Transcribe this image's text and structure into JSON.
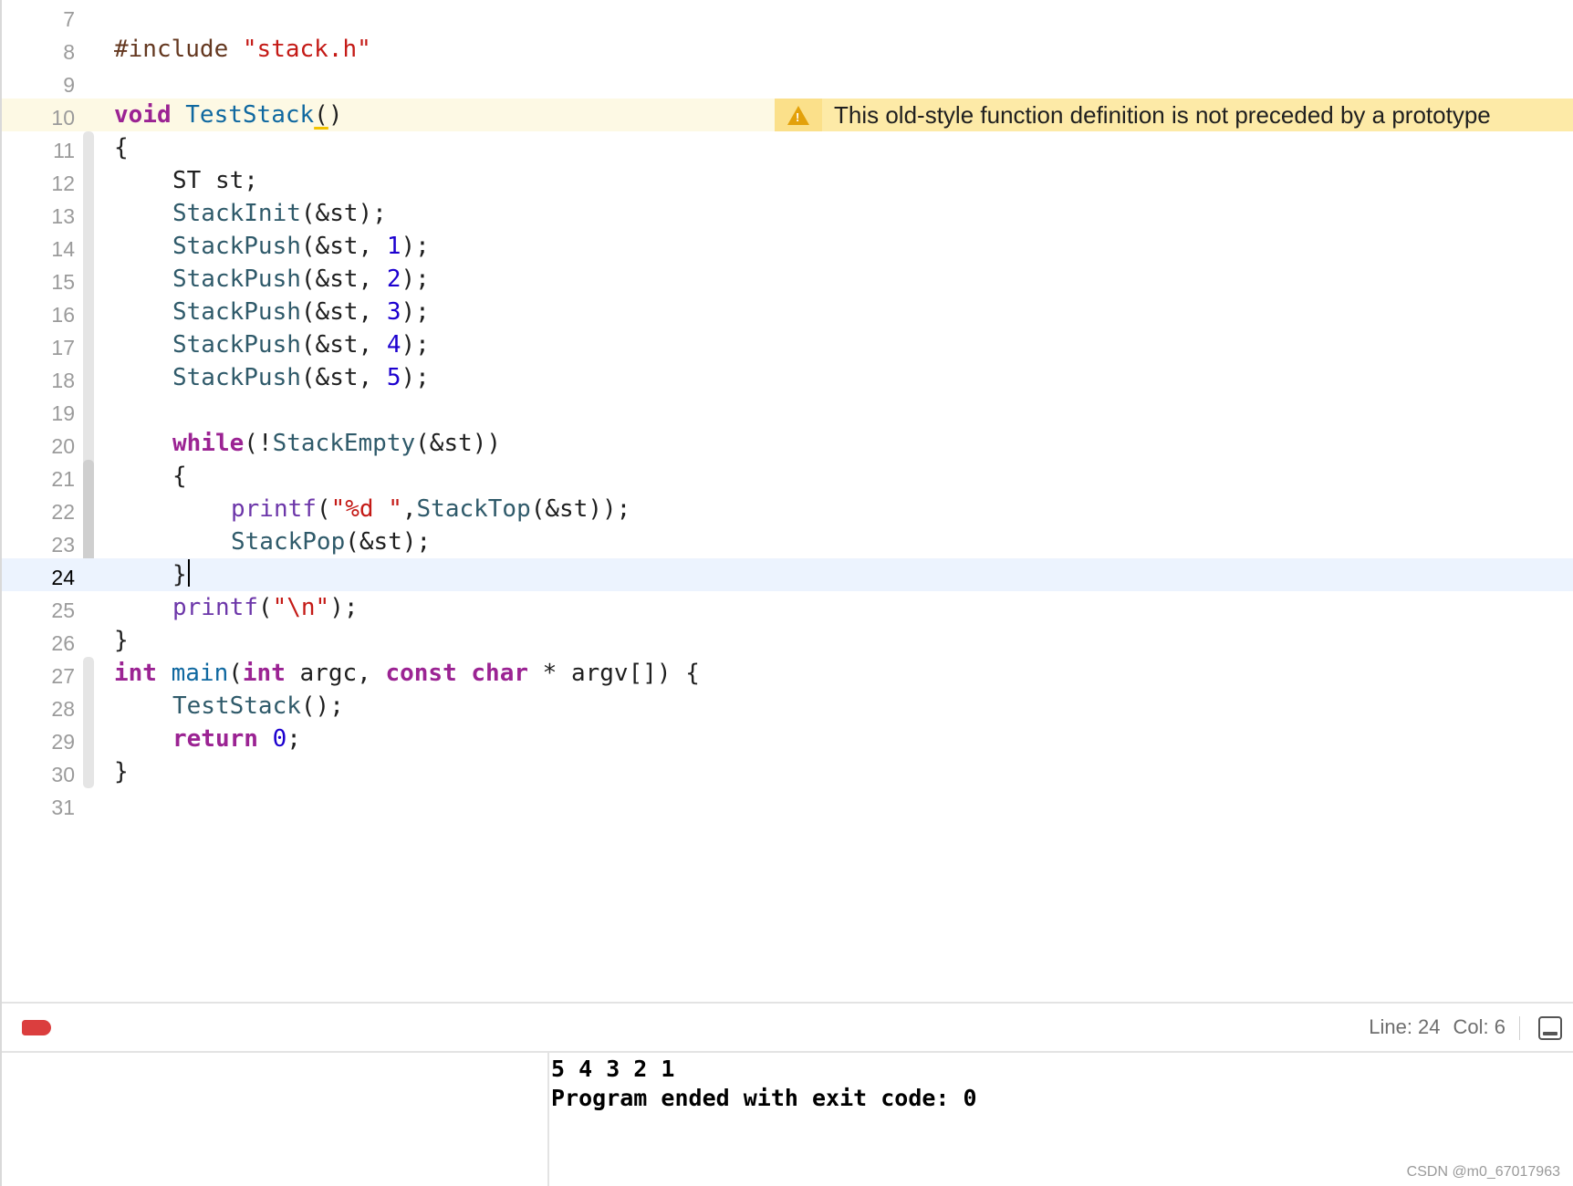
{
  "editor": {
    "current_line": "24",
    "lines": [
      {
        "n": "7"
      },
      {
        "n": "8"
      },
      {
        "n": "9"
      },
      {
        "n": "10"
      },
      {
        "n": "11"
      },
      {
        "n": "12"
      },
      {
        "n": "13"
      },
      {
        "n": "14"
      },
      {
        "n": "15"
      },
      {
        "n": "16"
      },
      {
        "n": "17"
      },
      {
        "n": "18"
      },
      {
        "n": "19"
      },
      {
        "n": "20"
      },
      {
        "n": "21"
      },
      {
        "n": "22"
      },
      {
        "n": "23"
      },
      {
        "n": "24"
      },
      {
        "n": "25"
      },
      {
        "n": "26"
      },
      {
        "n": "27"
      },
      {
        "n": "28"
      },
      {
        "n": "29"
      },
      {
        "n": "30"
      },
      {
        "n": "31"
      }
    ],
    "tokens": {
      "l8_pre": "#include ",
      "l8_str": "\"stack.h\"",
      "l10_kw": "void",
      "l10_name": "TestStack",
      "l10_paren_open": "(",
      "l10_paren_close": ")",
      "open_brace": "{",
      "close_brace": "}",
      "l12": "ST st;",
      "stackinit": "StackInit",
      "stackpush": "StackPush",
      "arg_st": "(&st);",
      "push_arg": "(&st, ",
      "call_end": ");",
      "n1": "1",
      "n2": "2",
      "n3": "3",
      "n4": "4",
      "n5": "5",
      "while": "while",
      "not_open": "(!",
      "stackempty": "StackEmpty",
      "empty_arg": "(&st))",
      "printf": "printf",
      "paren_open": "(",
      "fmt_str": "\"%d \"",
      "comma": ",",
      "stacktop": "StackTop",
      "top_arg": "(&st));",
      "stackpop": "StackPop",
      "newline_str": "\"\\n\"",
      "int": "int",
      "main": "main",
      "argc": " argc, ",
      "const": "const",
      "char": "char",
      "argv": " * argv[]) {",
      "teststack_call": "TestStack",
      "call_empty": "();",
      "return": "return",
      "zero": "0",
      "semicolon": ";",
      "space": " "
    },
    "warning": {
      "icon": "warning-triangle-icon",
      "message": "This old-style function definition is not preceded by a prototype"
    }
  },
  "debug_bar": {
    "line_label": "Line: 24",
    "col_label": "Col: 6"
  },
  "console": {
    "output_line1": "5 4 3 2 1",
    "output_line2": "Program ended with exit code: 0"
  },
  "watermark": "CSDN @m0_67017963",
  "colors": {
    "keyword": "#9b2393",
    "string": "#c41a16",
    "number": "#1c00cf",
    "preprocessor": "#643820",
    "current_line_bg": "#ecf3fe",
    "warning_bg": "#fdeaa7",
    "breakpoint": "#db3e3e"
  }
}
